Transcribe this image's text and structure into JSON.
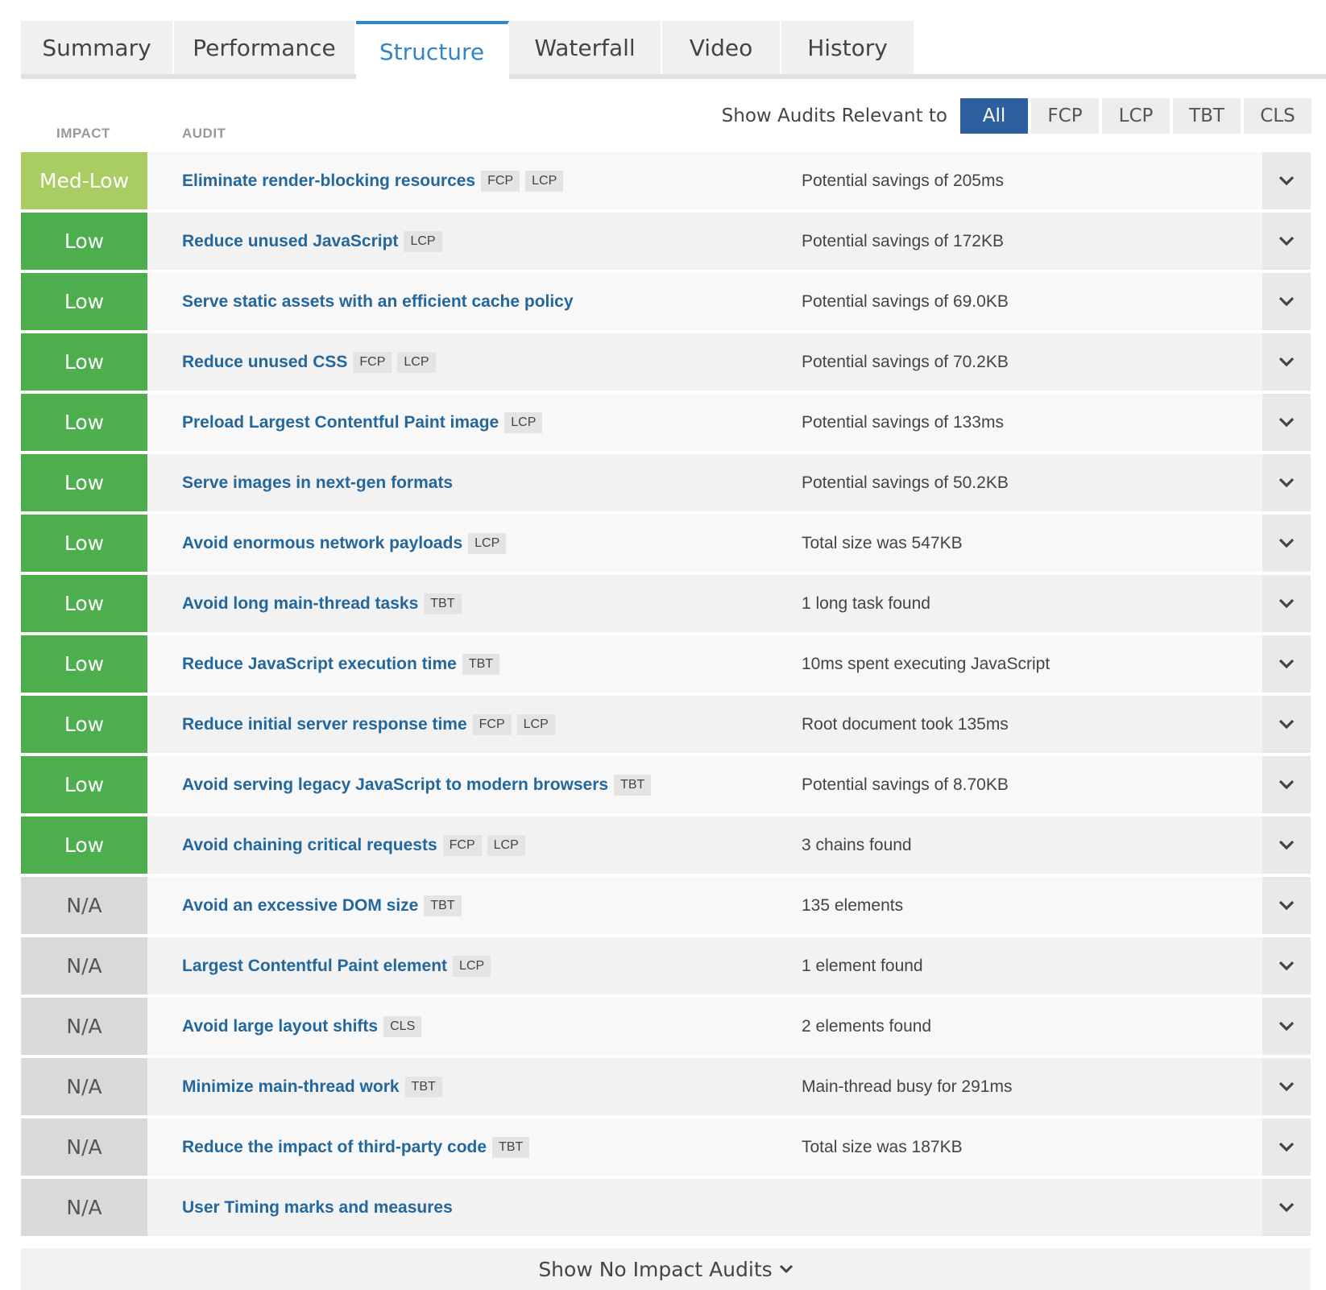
{
  "tabs": [
    {
      "label": "Summary",
      "active": false
    },
    {
      "label": "Performance",
      "active": false
    },
    {
      "label": "Structure",
      "active": true
    },
    {
      "label": "Waterfall",
      "active": false
    },
    {
      "label": "Video",
      "active": false
    },
    {
      "label": "History",
      "active": false
    }
  ],
  "table_headers": {
    "impact": "IMPACT",
    "audit": "AUDIT"
  },
  "filter": {
    "label": "Show Audits Relevant to",
    "options": [
      "All",
      "FCP",
      "LCP",
      "TBT",
      "CLS"
    ],
    "selected": "All"
  },
  "audits": [
    {
      "impact": "Med-Low",
      "title": "Eliminate render-blocking resources",
      "tags": [
        "FCP",
        "LCP"
      ],
      "detail": "Potential savings of 205ms"
    },
    {
      "impact": "Low",
      "title": "Reduce unused JavaScript",
      "tags": [
        "LCP"
      ],
      "detail": "Potential savings of 172KB"
    },
    {
      "impact": "Low",
      "title": "Serve static assets with an efficient cache policy",
      "tags": [],
      "detail": "Potential savings of 69.0KB"
    },
    {
      "impact": "Low",
      "title": "Reduce unused CSS",
      "tags": [
        "FCP",
        "LCP"
      ],
      "detail": "Potential savings of 70.2KB"
    },
    {
      "impact": "Low",
      "title": "Preload Largest Contentful Paint image",
      "tags": [
        "LCP"
      ],
      "detail": "Potential savings of 133ms"
    },
    {
      "impact": "Low",
      "title": "Serve images in next-gen formats",
      "tags": [],
      "detail": "Potential savings of 50.2KB"
    },
    {
      "impact": "Low",
      "title": "Avoid enormous network payloads",
      "tags": [
        "LCP"
      ],
      "detail": "Total size was 547KB"
    },
    {
      "impact": "Low",
      "title": "Avoid long main-thread tasks",
      "tags": [
        "TBT"
      ],
      "detail": "1 long task found"
    },
    {
      "impact": "Low",
      "title": "Reduce JavaScript execution time",
      "tags": [
        "TBT"
      ],
      "detail": "10ms spent executing JavaScript"
    },
    {
      "impact": "Low",
      "title": "Reduce initial server response time",
      "tags": [
        "FCP",
        "LCP"
      ],
      "detail": "Root document took 135ms"
    },
    {
      "impact": "Low",
      "title": "Avoid serving legacy JavaScript to modern browsers",
      "tags": [
        "TBT"
      ],
      "detail": "Potential savings of 8.70KB"
    },
    {
      "impact": "Low",
      "title": "Avoid chaining critical requests",
      "tags": [
        "FCP",
        "LCP"
      ],
      "detail": "3 chains found"
    },
    {
      "impact": "N/A",
      "title": "Avoid an excessive DOM size",
      "tags": [
        "TBT"
      ],
      "detail": "135 elements"
    },
    {
      "impact": "N/A",
      "title": "Largest Contentful Paint element",
      "tags": [
        "LCP"
      ],
      "detail": "1 element found"
    },
    {
      "impact": "N/A",
      "title": "Avoid large layout shifts",
      "tags": [
        "CLS"
      ],
      "detail": "2 elements found"
    },
    {
      "impact": "N/A",
      "title": "Minimize main-thread work",
      "tags": [
        "TBT"
      ],
      "detail": "Main-thread busy for 291ms"
    },
    {
      "impact": "N/A",
      "title": "Reduce the impact of third-party code",
      "tags": [
        "TBT"
      ],
      "detail": "Total size was 187KB"
    },
    {
      "impact": "N/A",
      "title": "User Timing marks and measures",
      "tags": [],
      "detail": ""
    }
  ],
  "show_more_label": "Show No Impact Audits",
  "icons": {
    "expand": "chevron-down-icon"
  },
  "colors": {
    "accent": "#2f86c8",
    "filter_active": "#2b5f9e",
    "impact_med_low": "#a9cc63",
    "impact_low": "#4cae4c",
    "impact_na": "#d9d9d9",
    "link": "#23679e"
  }
}
